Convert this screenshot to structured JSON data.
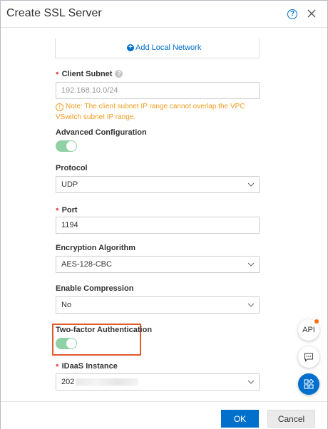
{
  "dialog": {
    "title": "Create SSL Server",
    "help_icon": "question-circle-icon",
    "close_icon": "close-icon"
  },
  "form": {
    "add_local_network": "Add Local Network",
    "client_subnet": {
      "label": "Client Subnet",
      "placeholder": "192.168.10.0/24",
      "note": "Note: The client subnet IP range cannot overlap the VPC VSwitch subnet IP range."
    },
    "advanced_configuration": {
      "label": "Advanced Configuration",
      "enabled": true
    },
    "protocol": {
      "label": "Protocol",
      "value": "UDP"
    },
    "port": {
      "label": "Port",
      "value": "1194"
    },
    "encryption_algorithm": {
      "label": "Encryption Algorithm",
      "value": "AES-128-CBC"
    },
    "enable_compression": {
      "label": "Enable Compression",
      "value": "No"
    },
    "two_factor_authentication": {
      "label": "Two-factor Authentication",
      "enabled": true
    },
    "idaas_instance": {
      "label": "IDaaS Instance",
      "value_prefix": "202"
    }
  },
  "footer": {
    "ok_label": "OK",
    "cancel_label": "Cancel"
  },
  "floating": {
    "api_label": "API"
  },
  "colors": {
    "primary": "#0070cc",
    "toggle_on": "#8fd0a5",
    "warning": "#f29c1f",
    "required": "#e8595a",
    "highlight": "#e05a2c"
  }
}
